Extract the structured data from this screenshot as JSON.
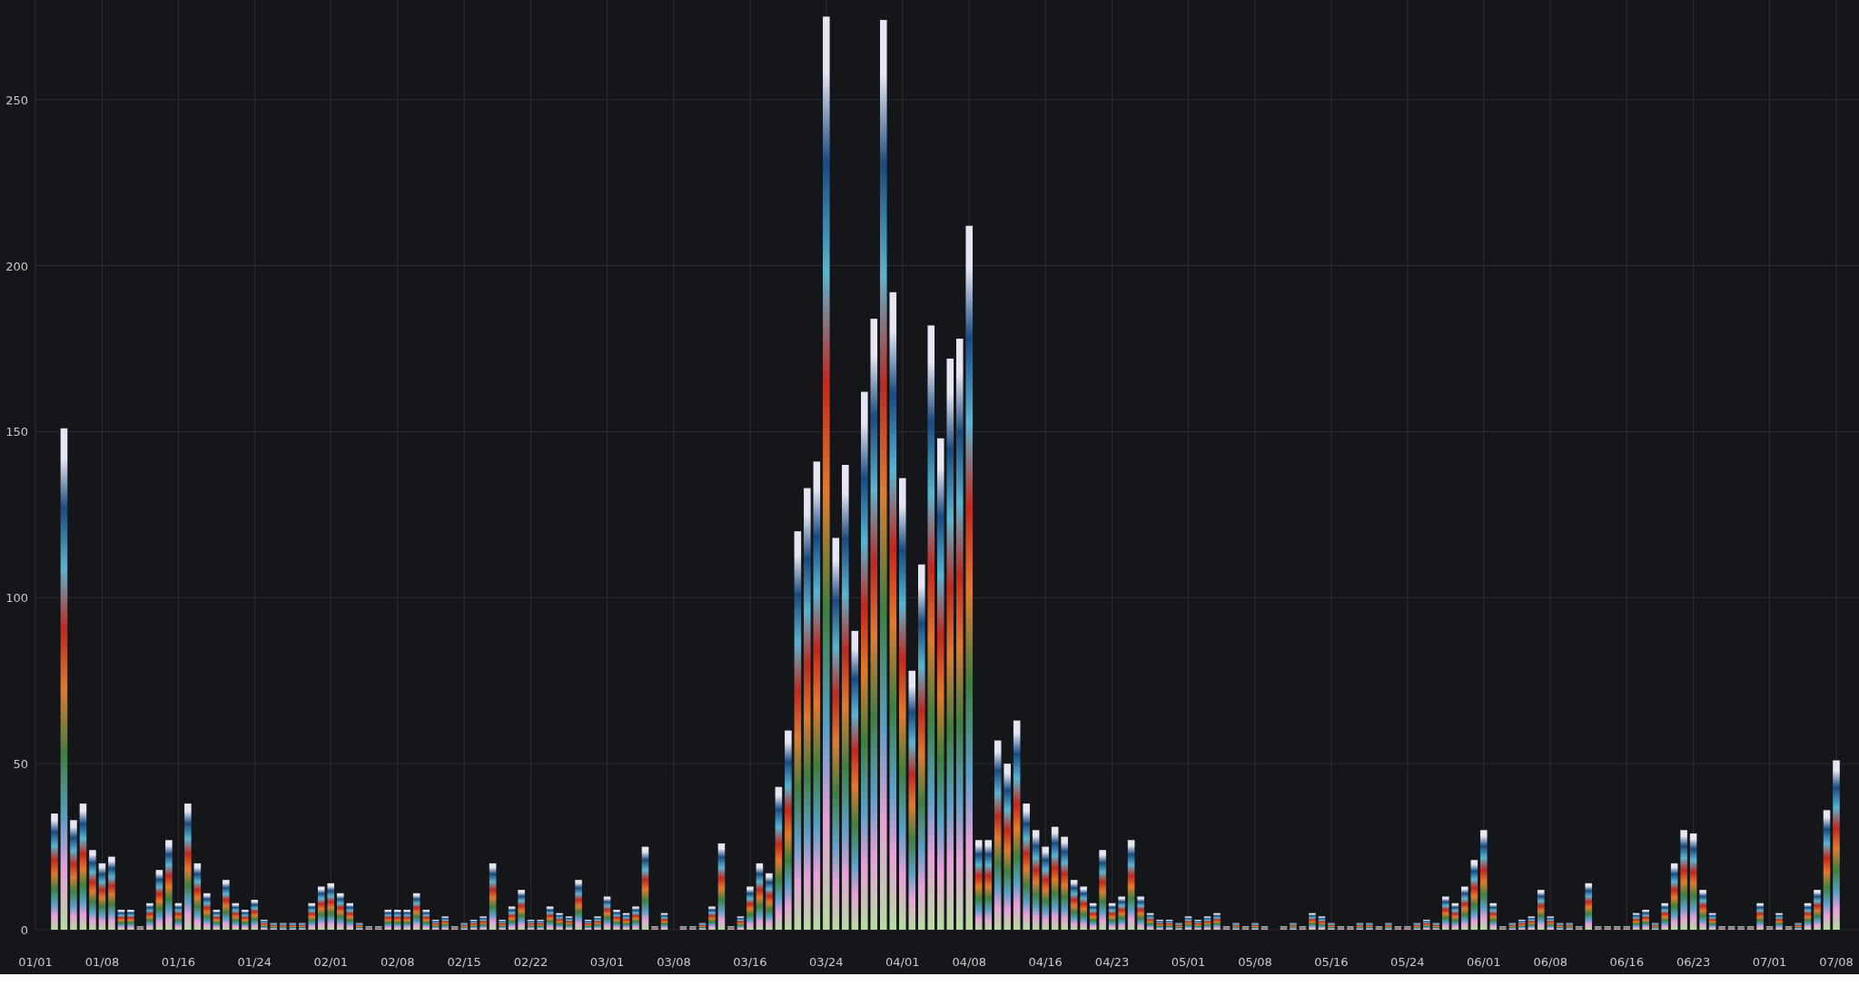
{
  "chart_data": {
    "type": "bar",
    "stacked": true,
    "grid": true,
    "ylim": [
      0,
      280
    ],
    "yticks": [
      0,
      50,
      100,
      150,
      200,
      250
    ],
    "categories": [
      "01/01",
      null,
      null,
      null,
      null,
      null,
      null,
      "01/08",
      null,
      null,
      null,
      null,
      null,
      null,
      null,
      "01/16",
      null,
      null,
      null,
      null,
      null,
      null,
      null,
      "01/24",
      null,
      null,
      null,
      null,
      null,
      null,
      null,
      "02/01",
      null,
      null,
      null,
      null,
      null,
      null,
      "02/08",
      null,
      null,
      null,
      null,
      null,
      null,
      "02/15",
      null,
      null,
      null,
      null,
      null,
      null,
      "02/22",
      null,
      null,
      null,
      null,
      null,
      null,
      null,
      "03/01",
      null,
      null,
      null,
      null,
      null,
      null,
      "03/08",
      null,
      null,
      null,
      null,
      null,
      null,
      null,
      "03/16",
      null,
      null,
      null,
      null,
      null,
      null,
      null,
      "03/24",
      null,
      null,
      null,
      null,
      null,
      null,
      null,
      "04/01",
      null,
      null,
      null,
      null,
      null,
      null,
      "04/08",
      null,
      null,
      null,
      null,
      null,
      null,
      null,
      "04/16",
      null,
      null,
      null,
      null,
      null,
      null,
      "04/23",
      null,
      null,
      null,
      null,
      null,
      null,
      null,
      "05/01",
      null,
      null,
      null,
      null,
      null,
      null,
      "05/08",
      null,
      null,
      null,
      null,
      null,
      null,
      null,
      "05/16",
      null,
      null,
      null,
      null,
      null,
      null,
      null,
      "05/24",
      null,
      null,
      null,
      null,
      null,
      null,
      null,
      "06/01",
      null,
      null,
      null,
      null,
      null,
      null,
      "06/08",
      null,
      null,
      null,
      null,
      null,
      null,
      null,
      "06/16",
      null,
      null,
      null,
      null,
      null,
      null,
      "06/23",
      null,
      null,
      null,
      null,
      null,
      null,
      null,
      "07/01",
      null,
      null,
      null,
      null,
      null,
      null,
      "07/08"
    ],
    "values": [
      0,
      0,
      35,
      151,
      33,
      38,
      24,
      20,
      22,
      6,
      6,
      1,
      8,
      18,
      27,
      8,
      38,
      20,
      11,
      6,
      15,
      8,
      6,
      9,
      3,
      2,
      2,
      2,
      2,
      8,
      13,
      14,
      11,
      8,
      2,
      1,
      1,
      6,
      6,
      6,
      11,
      6,
      3,
      4,
      1,
      2,
      3,
      4,
      20,
      3,
      7,
      12,
      3,
      3,
      7,
      5,
      4,
      15,
      3,
      4,
      10,
      6,
      5,
      7,
      25,
      1,
      5,
      0,
      1,
      1,
      2,
      7,
      26,
      1,
      4,
      13,
      20,
      17,
      43,
      60,
      120,
      133,
      141,
      275,
      118,
      140,
      90,
      162,
      184,
      274,
      192,
      136,
      78,
      110,
      182,
      148,
      172,
      178,
      212,
      27,
      27,
      57,
      50,
      63,
      38,
      30,
      25,
      31,
      28,
      15,
      13,
      8,
      24,
      8,
      10,
      27,
      10,
      5,
      3,
      3,
      2,
      4,
      3,
      4,
      5,
      1,
      2,
      1,
      2,
      1,
      0,
      1,
      2,
      1,
      5,
      4,
      2,
      1,
      1,
      2,
      2,
      1,
      2,
      1,
      1,
      2,
      3,
      2,
      10,
      8,
      13,
      21,
      30,
      8,
      1,
      2,
      3,
      4,
      12,
      4,
      2,
      2,
      1,
      14,
      1,
      1,
      1,
      1,
      5,
      6,
      2,
      8,
      20,
      30,
      29,
      12,
      5,
      1,
      1,
      1,
      1,
      8,
      1,
      5,
      1,
      2,
      8,
      12,
      36,
      51
    ]
  }
}
